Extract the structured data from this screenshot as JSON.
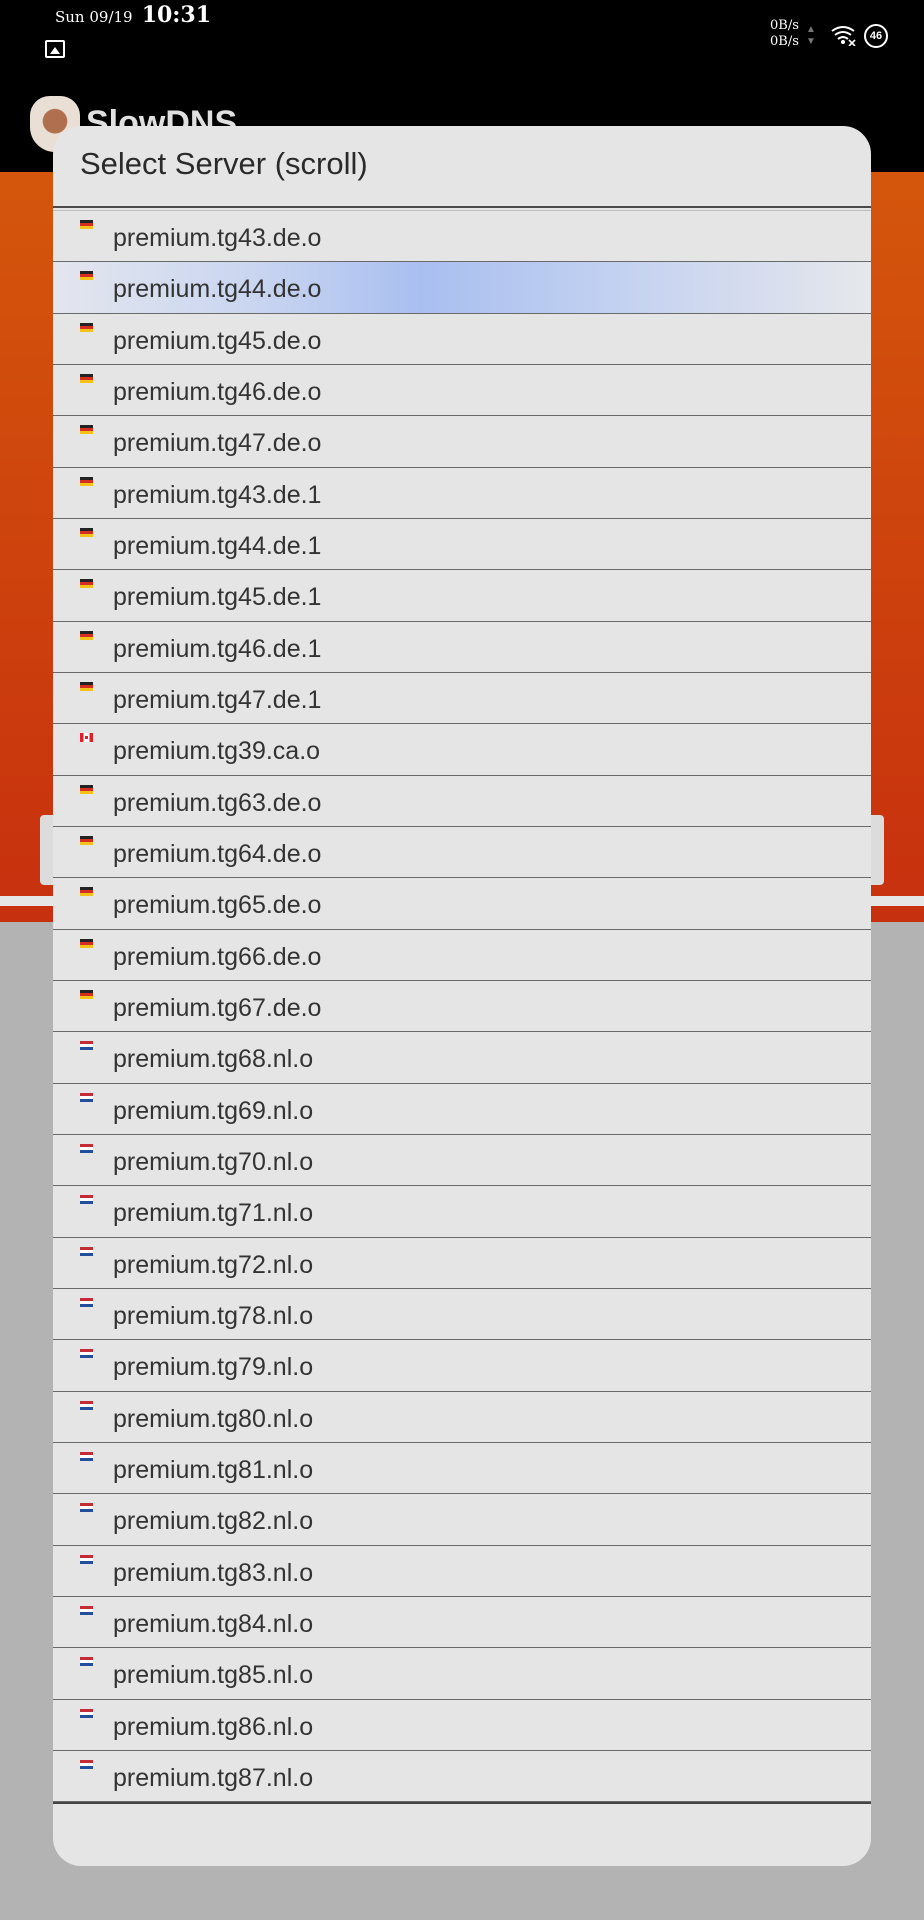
{
  "status_bar": {
    "date": "Sun 09/19",
    "time": "10:31",
    "net_up": "0B/s",
    "net_down": "0B/s",
    "battery": "46"
  },
  "app": {
    "title": "SlowDNS",
    "accent_color": "#d4560c"
  },
  "dialog": {
    "title": "Select Server (scroll)",
    "selected_index": 1,
    "servers": [
      {
        "label": "premium.tg43.de.o",
        "flag": "de"
      },
      {
        "label": "premium.tg44.de.o",
        "flag": "de"
      },
      {
        "label": "premium.tg45.de.o",
        "flag": "de"
      },
      {
        "label": "premium.tg46.de.o",
        "flag": "de"
      },
      {
        "label": "premium.tg47.de.o",
        "flag": "de"
      },
      {
        "label": "premium.tg43.de.1",
        "flag": "de"
      },
      {
        "label": "premium.tg44.de.1",
        "flag": "de"
      },
      {
        "label": "premium.tg45.de.1",
        "flag": "de"
      },
      {
        "label": "premium.tg46.de.1",
        "flag": "de"
      },
      {
        "label": "premium.tg47.de.1",
        "flag": "de"
      },
      {
        "label": "premium.tg39.ca.o",
        "flag": "ca"
      },
      {
        "label": "premium.tg63.de.o",
        "flag": "de"
      },
      {
        "label": "premium.tg64.de.o",
        "flag": "de"
      },
      {
        "label": "premium.tg65.de.o",
        "flag": "de"
      },
      {
        "label": "premium.tg66.de.o",
        "flag": "de"
      },
      {
        "label": "premium.tg67.de.o",
        "flag": "de"
      },
      {
        "label": "premium.tg68.nl.o",
        "flag": "nl"
      },
      {
        "label": "premium.tg69.nl.o",
        "flag": "nl"
      },
      {
        "label": "premium.tg70.nl.o",
        "flag": "nl"
      },
      {
        "label": "premium.tg71.nl.o",
        "flag": "nl"
      },
      {
        "label": "premium.tg72.nl.o",
        "flag": "nl"
      },
      {
        "label": "premium.tg78.nl.o",
        "flag": "nl"
      },
      {
        "label": "premium.tg79.nl.o",
        "flag": "nl"
      },
      {
        "label": "premium.tg80.nl.o",
        "flag": "nl"
      },
      {
        "label": "premium.tg81.nl.o",
        "flag": "nl"
      },
      {
        "label": "premium.tg82.nl.o",
        "flag": "nl"
      },
      {
        "label": "premium.tg83.nl.o",
        "flag": "nl"
      },
      {
        "label": "premium.tg84.nl.o",
        "flag": "nl"
      },
      {
        "label": "premium.tg85.nl.o",
        "flag": "nl"
      },
      {
        "label": "premium.tg86.nl.o",
        "flag": "nl"
      },
      {
        "label": "premium.tg87.nl.o",
        "flag": "nl"
      }
    ]
  },
  "icons": {
    "gallery": "gallery-notification-icon",
    "wifi": "wifi-icon",
    "battery": "battery-icon",
    "flag_de": "germany-flag-icon",
    "flag_nl": "netherlands-flag-icon",
    "flag_ca": "canada-flag-icon"
  }
}
